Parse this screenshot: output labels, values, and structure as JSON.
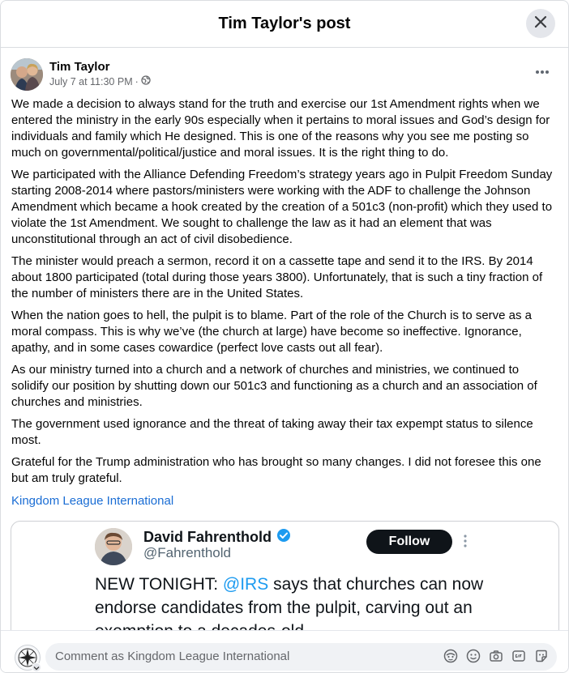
{
  "dialog": {
    "title": "Tim Taylor's post"
  },
  "post": {
    "author": "Tim Taylor",
    "time": "July 7 at 11:30 PM",
    "separator": "·",
    "privacy_icon": "globe-icon",
    "paragraphs": [
      "We made a decision to always stand for the truth and exercise our 1st Amendment rights when we entered the ministry in the early 90s especially when it pertains to moral issues and God’s design for individuals and family which He designed.  This is one of the reasons why you see me posting so much on governmental/political/justice and moral issues.  It is the right thing to do.",
      "We participated with the Alliance Defending Freedom’s strategy years ago in Pulpit Freedom Sunday starting 2008-2014 where pastors/ministers were working with the ADF to challenge the Johnson Amendment which became a hook created by the creation of a 501c3 (non-profit) which they used to violate the 1st Amendment.  We sought to challenge the law as it had an element that was unconstitutional through an act of civil disobedience.",
      "The minister would preach a sermon, record it on a cassette tape and send it to the IRS.  By 2014 about 1800 participated (total during those years 3800).  Unfortunately, that is such a tiny fraction of the number of ministers there are in the United States.",
      "When the nation goes to hell, the pulpit is to blame.  Part of the role of the Church is to serve as a moral compass.  This is why we’ve (the church at large) have become so ineffective.   Ignorance, apathy, and in some cases cowardice (perfect love casts out all fear).",
      "As our ministry turned into a church and a network of churches and ministries, we continued to solidify our position by shutting down our 501c3 and functioning as a church and an association of churches and ministries.",
      "The government used ignorance and the threat of taking away their tax expempt status to silence most.",
      "Grateful for the Trump administration who has brought so many changes.  I did not foresee this one but am truly grateful."
    ],
    "page_link": "Kingdom League International"
  },
  "embed": {
    "name": "David Fahrenthold",
    "handle": "@Fahrenthold",
    "follow_label": "Follow",
    "text_prefix": "NEW TONIGHT: ",
    "mention": "@IRS",
    "text_rest": " says that churches can now endorse candidates from the pulpit, carving out an exemption to a decades-old"
  },
  "composer": {
    "placeholder": "Comment as Kingdom League International",
    "icons": [
      "avatar-sticker-icon",
      "emoji-icon",
      "camera-icon",
      "gif-icon",
      "sticker-icon"
    ]
  },
  "colors": {
    "link": "#1a6dd4",
    "mention": "#1d9bf0",
    "follow_bg": "#0f1419",
    "close_bg": "#e4e6eb"
  }
}
